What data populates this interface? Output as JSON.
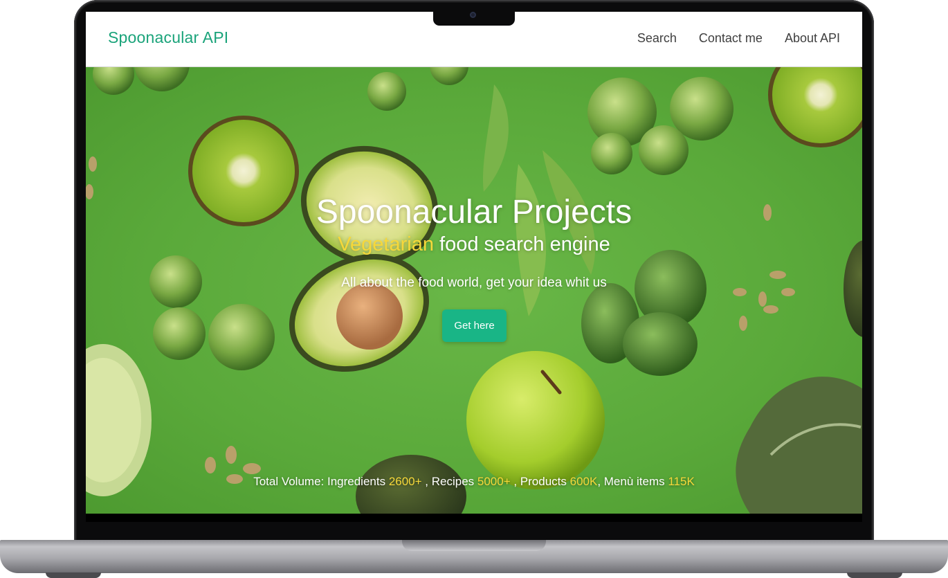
{
  "navbar": {
    "brand": "Spoonacular API",
    "links": [
      "Search",
      "Contact me",
      "About API"
    ]
  },
  "hero": {
    "title": "Spoonacular Projects",
    "subtitle_highlight": "Vegetarian",
    "subtitle_rest": " food search engine",
    "description": "All about the food world, get your idea whit us",
    "cta_label": "Get here",
    "stats": {
      "prefix": "Total Volume: Ingredients ",
      "ingredients": "2600+",
      "recipes_label": " , Recipes ",
      "recipes": "5000+",
      "products_label": " , Products ",
      "products": "600K",
      "menu_label": ", Menù items ",
      "menu_items": "115K"
    }
  },
  "colors": {
    "brand": "#1aa37a",
    "accent_yellow": "#f6d83a",
    "cta": "#19b586",
    "hero_bg": "#5fae3c"
  }
}
